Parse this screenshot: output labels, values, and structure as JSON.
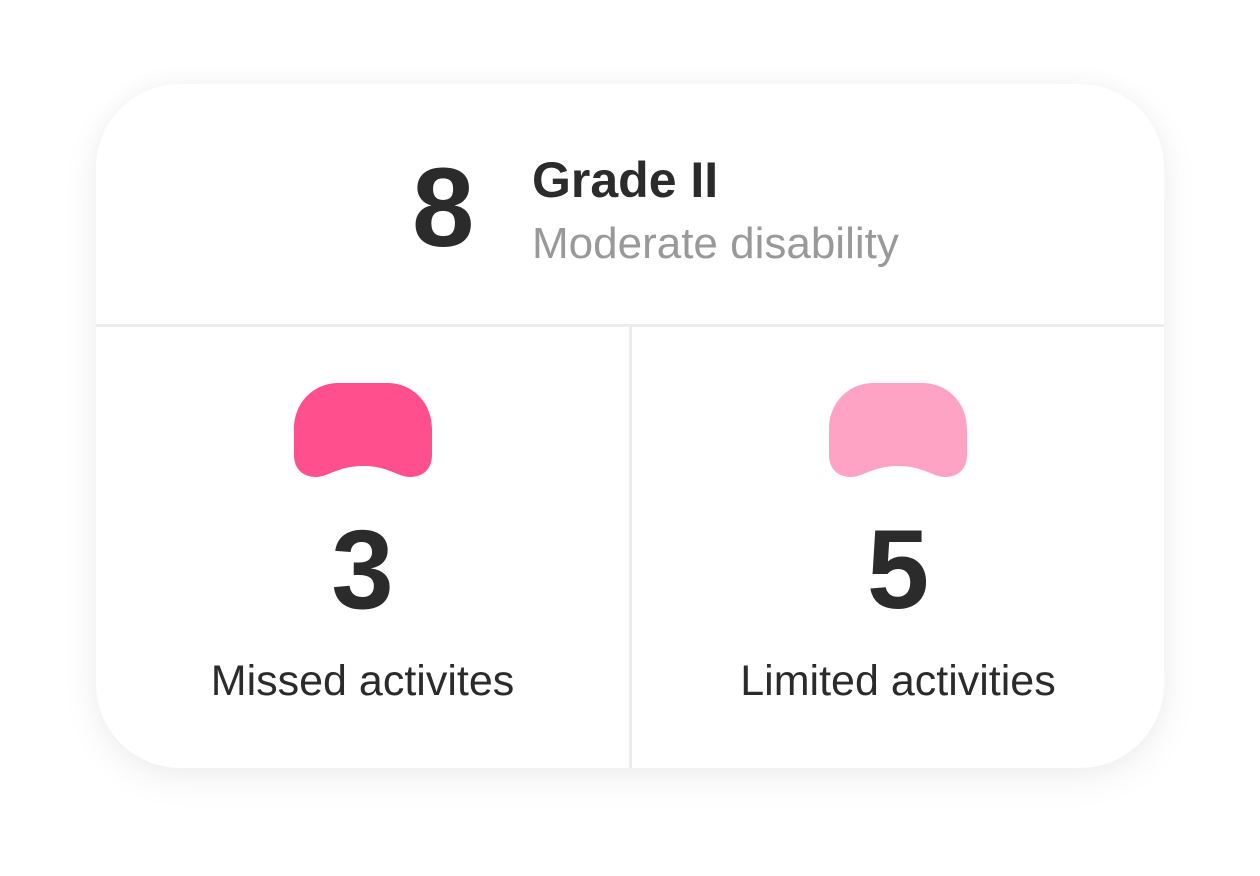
{
  "summary": {
    "score": "8",
    "grade": "Grade II",
    "severity": "Moderate disability"
  },
  "stats": [
    {
      "value": "3",
      "label": "Missed activites",
      "icon": "blob-icon",
      "color": "#ff4f8d"
    },
    {
      "value": "5",
      "label": "Limited activities",
      "icon": "blob-icon",
      "color": "#ffa3c4"
    }
  ]
}
